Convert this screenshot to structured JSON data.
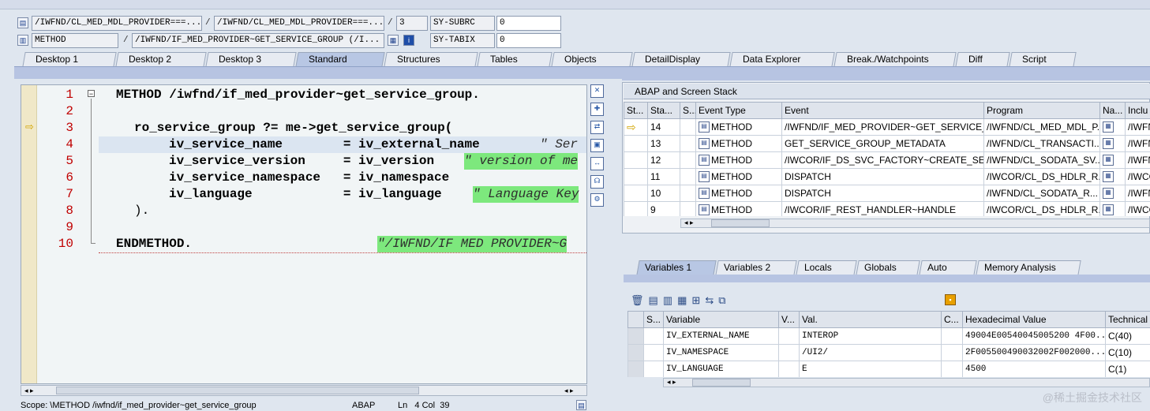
{
  "header": {
    "row1": {
      "program_field_1": "/IWFND/CL_MED_MDL_PROVIDER===...",
      "program_field_2": "/IWFND/CL_MED_MDL_PROVIDER===...",
      "line": "3",
      "sysvar_name": "SY-SUBRC",
      "sysvar_value": "0",
      "separator": "/"
    },
    "row2": {
      "event_type": "METHOD",
      "event_name": "/IWFND/IF_MED_PROVIDER~GET_SERVICE_GROUP (/I...",
      "sysvar_name": "SY-TABIX",
      "sysvar_value": "0",
      "separator": "/"
    }
  },
  "tabs": [
    "Desktop 1",
    "Desktop 2",
    "Desktop 3",
    "Standard",
    "Structures",
    "Tables",
    "Objects",
    "DetailDisplay",
    "Data Explorer",
    "Break./Watchpoints",
    "Diff",
    "Script"
  ],
  "active_tab": "Standard",
  "editor": {
    "line_numbers": [
      "1",
      "2",
      "3",
      "4",
      "5",
      "6",
      "7",
      "8",
      "9",
      "10"
    ],
    "lines": {
      "l1_kw": "METHOD /iwfnd/if_med_provider~get_service_group.",
      "l3_a": "ro_service_group ?= me->get_service_group(",
      "l4_a": "iv_service_name        = iv_external_name",
      "l4_c": "\" Ser",
      "l5_a": "iv_service_version     = iv_version",
      "l5_c": "\" version of me",
      "l6_a": "iv_service_namespace   = iv_namespace",
      "l7_a": "iv_language            = iv_language",
      "l7_c": "\" Language Key",
      "l8_a": ").",
      "l10_kw": "ENDMETHOD.",
      "l10_c": "\"/IWFND/IF MED PROVIDER~G"
    }
  },
  "status_bar": {
    "scope": "Scope: \\METHOD /iwfnd/if_med_provider~get_service_group",
    "lang": "ABAP",
    "position": "Ln   4 Col  39"
  },
  "stack_panel": {
    "title": "ABAP and Screen Stack",
    "columns": [
      "St...",
      "Sta...",
      "S...",
      "Event Type",
      "Event",
      "Program",
      "Na...",
      "Inclu"
    ],
    "rows": [
      {
        "level": "14",
        "event_type": "METHOD",
        "event": "/IWFND/IF_MED_PROVIDER~GET_SERVICE_...",
        "program": "/IWFND/CL_MED_MDL_P...",
        "include": "/IWFN"
      },
      {
        "level": "13",
        "event_type": "METHOD",
        "event": "GET_SERVICE_GROUP_METADATA",
        "program": "/IWFND/CL_TRANSACTI...",
        "include": "/IWFN"
      },
      {
        "level": "12",
        "event_type": "METHOD",
        "event": "/IWCOR/IF_DS_SVC_FACTORY~CREATE_SE...",
        "program": "/IWFND/CL_SODATA_SV...",
        "include": "/IWFN"
      },
      {
        "level": "11",
        "event_type": "METHOD",
        "event": "DISPATCH",
        "program": "/IWCOR/CL_DS_HDLR_R...",
        "include": "/IWCO"
      },
      {
        "level": "10",
        "event_type": "METHOD",
        "event": "DISPATCH",
        "program": "/IWFND/CL_SODATA_R...",
        "include": "/IWFN"
      },
      {
        "level": "9",
        "event_type": "METHOD",
        "event": "/IWCOR/IF_REST_HANDLER~HANDLE",
        "program": "/IWCOR/CL_DS_HDLR_R...",
        "include": "/IWCO"
      }
    ]
  },
  "var_tabs": [
    "Variables 1",
    "Variables 2",
    "Locals",
    "Globals",
    "Auto",
    "Memory Analysis"
  ],
  "active_var_tab": "Variables 1",
  "variables": {
    "columns": [
      "S...",
      "Variable",
      "V...",
      "Val.",
      "C...",
      "Hexadecimal Value",
      "Technical T"
    ],
    "rows": [
      {
        "name": "IV_EXTERNAL_NAME",
        "value": "INTEROP",
        "hex": "49004E00540045005200 4F00...",
        "type": "C(40)"
      },
      {
        "name": "IV_NAMESPACE",
        "value": "/UI2/",
        "hex": "2F005500490032002F002000...",
        "type": "C(10)"
      },
      {
        "name": "IV_LANGUAGE",
        "value": "E",
        "hex": "4500",
        "type": "C(1)"
      }
    ]
  },
  "watermark": "@稀土掘金技术社区"
}
